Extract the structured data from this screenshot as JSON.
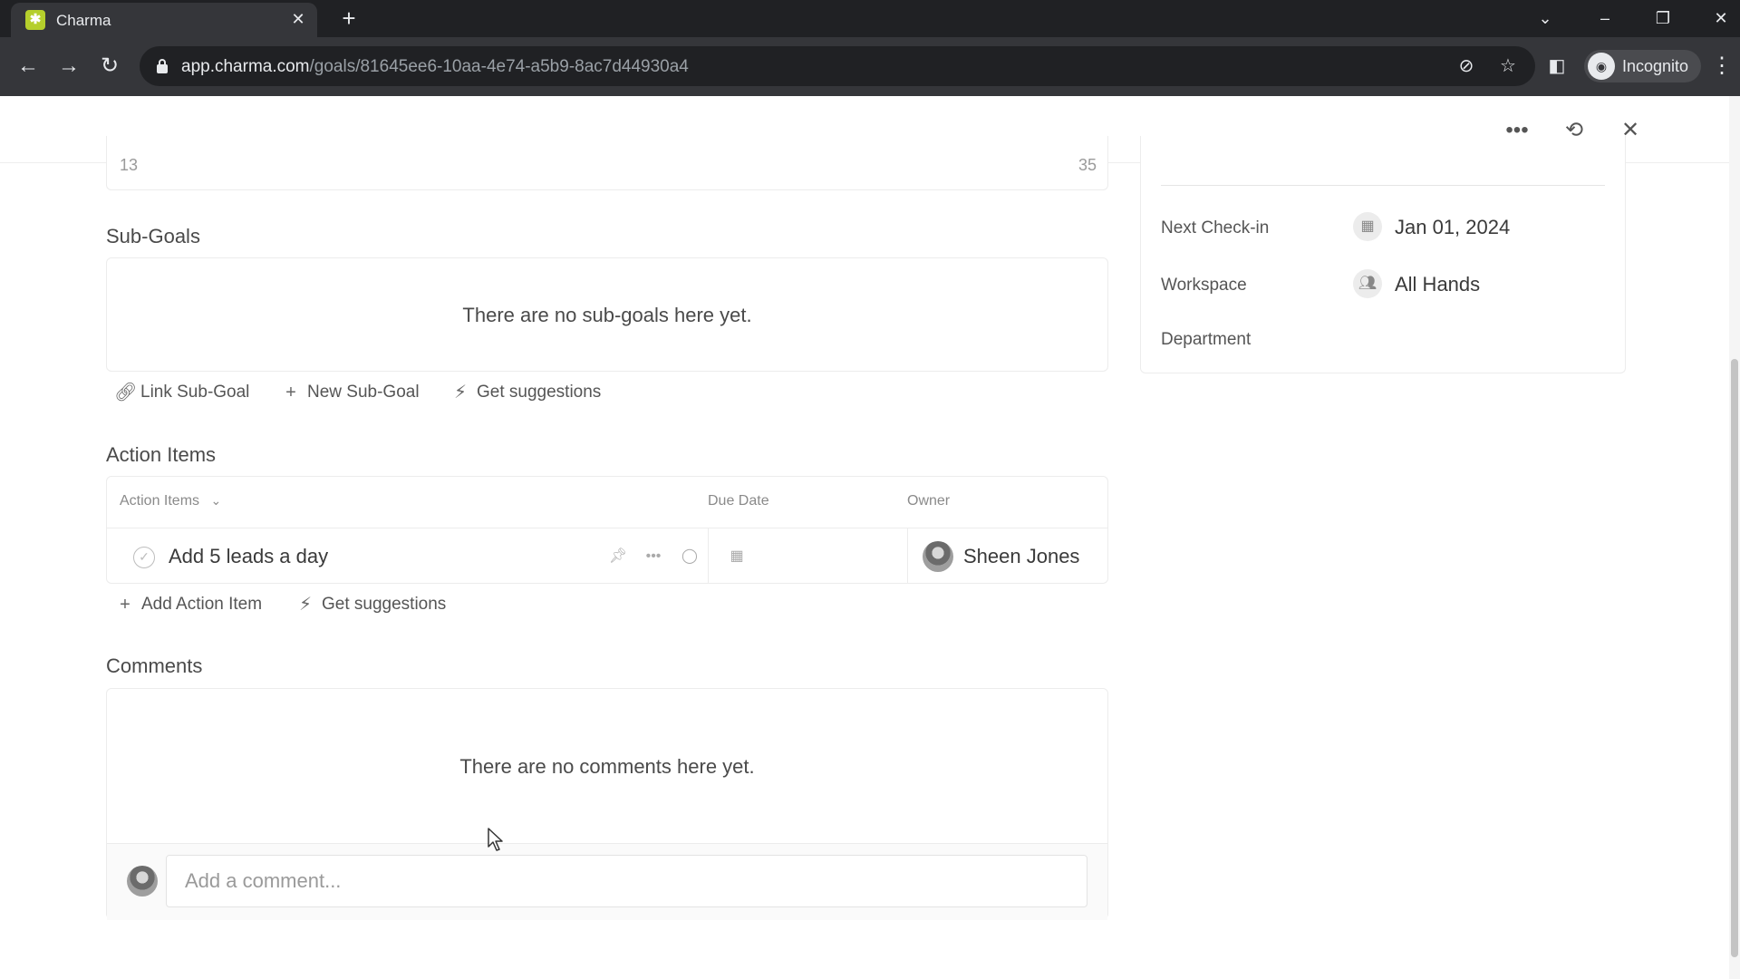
{
  "browser": {
    "tab_title": "Charma",
    "url_host": "app.charma.com",
    "url_path": "/goals/81645ee6-10aa-4e74-a5b9-8ac7d44930a4",
    "incognito_label": "Incognito"
  },
  "progress": {
    "start_label": "13",
    "end_label": "35"
  },
  "sub_goals": {
    "title": "Sub-Goals",
    "empty_text": "There are no sub-goals here yet.",
    "actions": {
      "link": "Link Sub-Goal",
      "new": "New Sub-Goal",
      "suggest": "Get suggestions"
    }
  },
  "action_items": {
    "title": "Action Items",
    "columns": {
      "items": "Action Items",
      "due_date": "Due Date",
      "owner": "Owner"
    },
    "rows": [
      {
        "title": "Add 5 leads a day",
        "owner": "Sheen Jones"
      }
    ],
    "actions": {
      "add": "Add Action Item",
      "suggest": "Get suggestions"
    }
  },
  "comments": {
    "title": "Comments",
    "empty_text": "There are no comments here yet.",
    "input_placeholder": "Add a comment..."
  },
  "details": {
    "next_checkin_label": "Next Check-in",
    "next_checkin_value": "Jan 01, 2024",
    "workspace_label": "Workspace",
    "workspace_value": "All Hands",
    "department_label": "Department"
  },
  "colors": {
    "brand": "#b5cf2c",
    "chrome_dark": "#202124",
    "chrome_toolbar": "#35363a"
  }
}
